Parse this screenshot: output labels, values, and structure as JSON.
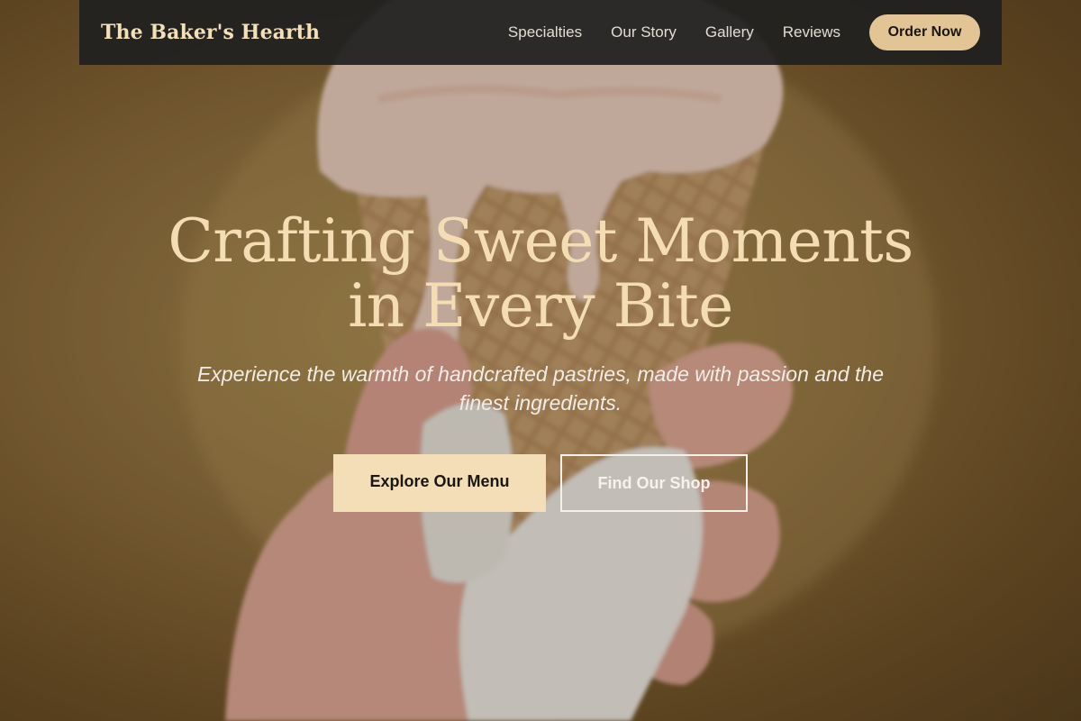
{
  "brand": {
    "name": "The Baker's Hearth"
  },
  "nav": {
    "links": [
      "Specialties",
      "Our Story",
      "Gallery",
      "Reviews"
    ],
    "order_label": "Order Now"
  },
  "hero": {
    "title_line1": "Crafting Sweet Moments",
    "title_line2": "in Every Bite",
    "subtitle": "Experience the warmth of handcrafted pastries, made with passion and the finest ingredients.",
    "primary_cta": "Explore Our Menu",
    "secondary_cta": "Find Our Shop"
  },
  "colors": {
    "accent": "#f4deb7",
    "order_button": "#e3c495",
    "brand_text": "#f3dfb8",
    "navbar_bg": "#202020"
  }
}
